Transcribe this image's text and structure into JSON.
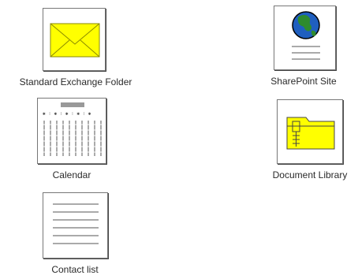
{
  "items": [
    {
      "label": "Standard Exchange Folder",
      "icon": "envelope-icon"
    },
    {
      "label": "SharePoint Site",
      "icon": "globe-page-icon"
    },
    {
      "label": "Calendar",
      "icon": "calendar-icon"
    },
    {
      "label": "Document Library",
      "icon": "folder-zipper-icon"
    },
    {
      "label": "Contact list",
      "icon": "document-lines-icon"
    }
  ],
  "colors": {
    "envelope": "#ffff00",
    "folder": "#ffff00",
    "globe_ocean": "#1f5fbf",
    "globe_land": "#2e8b2e"
  }
}
